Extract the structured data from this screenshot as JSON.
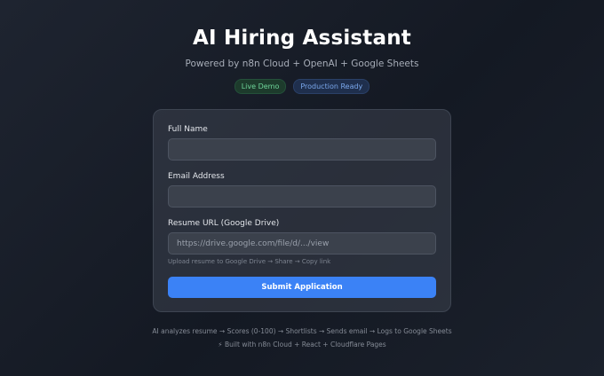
{
  "header": {
    "title": "AI Hiring Assistant",
    "subtitle": "Powered by n8n Cloud + OpenAI + Google Sheets",
    "badges": [
      "Live Demo",
      "Production Ready"
    ]
  },
  "form": {
    "full_name": {
      "label": "Full Name",
      "value": "",
      "placeholder": ""
    },
    "email": {
      "label": "Email Address",
      "value": "",
      "placeholder": ""
    },
    "resume_url": {
      "label": "Resume URL (Google Drive)",
      "value": "",
      "placeholder": "https://drive.google.com/file/d/.../view"
    },
    "hint": "Upload resume to Google Drive → Share → Copy link",
    "submit_label": "Submit Application"
  },
  "footer": {
    "pipeline": "AI analyzes resume → Scores (0-100) → Shortlists → Sends email → Logs to Google Sheets",
    "built_with": "⚡ Built with n8n Cloud + React + Cloudflare Pages"
  },
  "colors": {
    "accent": "#3b82f6",
    "badge_green": "#6fd69a",
    "badge_blue": "#7aa7ec"
  }
}
